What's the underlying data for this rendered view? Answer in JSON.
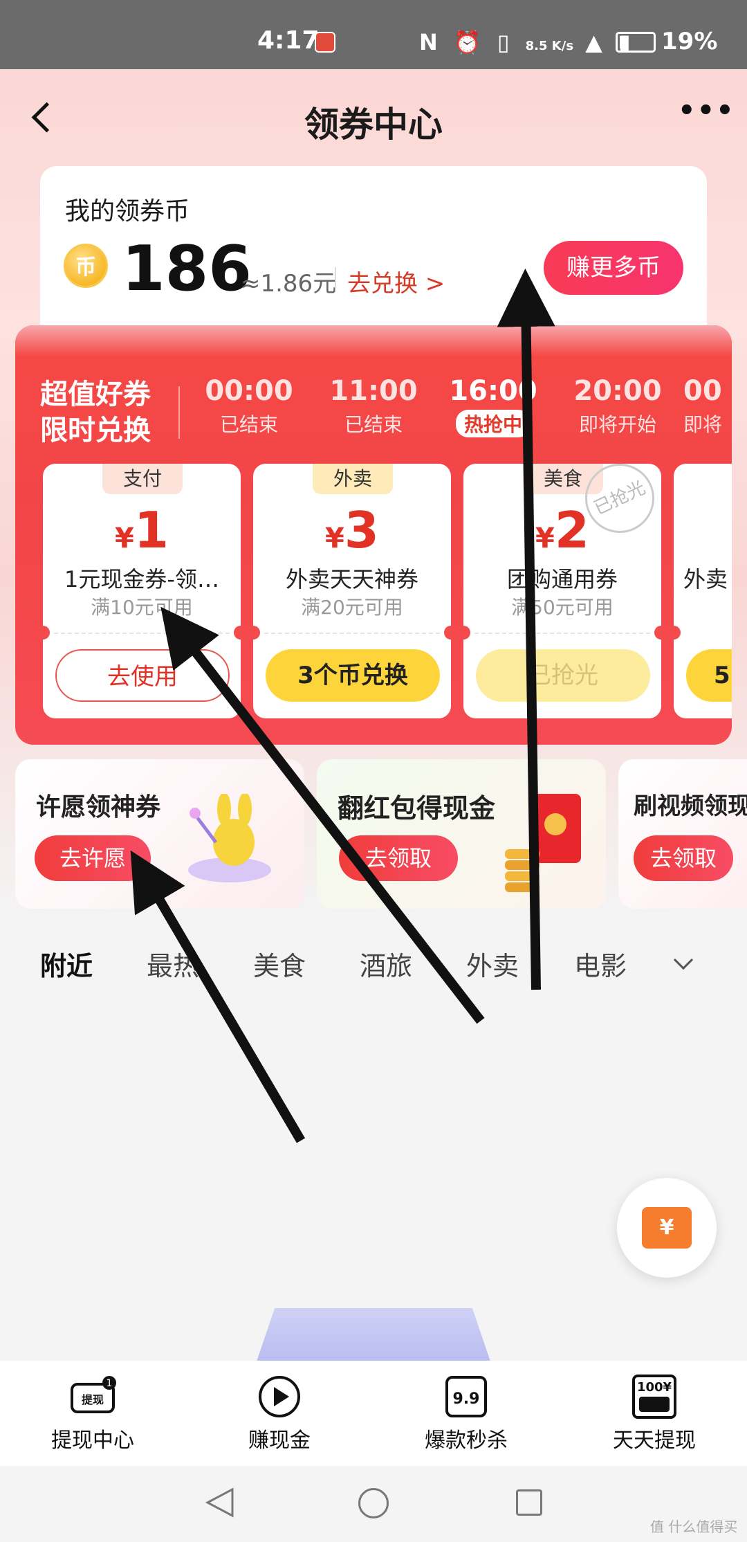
{
  "status_bar": {
    "time": "4:17",
    "net_speed": "8.5 K/s",
    "battery": "19%"
  },
  "header": {
    "title": "领券中心"
  },
  "coin_card": {
    "title": "我的领券币",
    "coin_symbol": "币",
    "balance": "186",
    "cash_equivalent": "≈1.86元",
    "exchange_link": "去兑换 >",
    "earn_button": "赚更多币"
  },
  "flash_sale": {
    "title_line1": "超值好券",
    "title_line2": "限时兑换",
    "slots": [
      {
        "time": "00:00",
        "status": "已结束"
      },
      {
        "time": "11:00",
        "status": "已结束"
      },
      {
        "time": "16:00",
        "status": "热抢中"
      },
      {
        "time": "20:00",
        "status": "即将开始"
      },
      {
        "time": "00",
        "status": "即将"
      }
    ],
    "coupons": [
      {
        "tag": "支付",
        "yen": "¥",
        "amount": "1",
        "name": "1元现金券-领…",
        "condition": "满10元可用",
        "button": "去使用"
      },
      {
        "tag": "外卖",
        "yen": "¥",
        "amount": "3",
        "name": "外卖天天神券",
        "condition": "满20元可用",
        "button": "3个币兑换"
      },
      {
        "tag": "美食",
        "yen": "¥",
        "amount": "2",
        "name": "团购通用券",
        "condition": "满50元可用",
        "button": "已抢光",
        "stamp": "已抢光"
      },
      {
        "tag": "",
        "yen": "",
        "amount": "",
        "name": "外卖",
        "condition": "",
        "button": "5"
      }
    ]
  },
  "tasks": [
    {
      "title": "许愿领神券",
      "button": "去许愿"
    },
    {
      "title": "翻红包得现金",
      "button": "去领取"
    },
    {
      "title": "刷视频领现",
      "button": "去领取"
    }
  ],
  "feed_tabs": [
    "附近",
    "最热",
    "美食",
    "酒旅",
    "外卖",
    "电影"
  ],
  "bottom_nav": [
    {
      "label": "提现中心",
      "icon_text": "提现",
      "badge": "1"
    },
    {
      "label": "赚现金",
      "icon_text": ""
    },
    {
      "label": "爆款秒杀",
      "icon_text": "9.9"
    },
    {
      "label": "天天提现",
      "icon_text": "100¥"
    }
  ],
  "float_button": {
    "symbol": "¥"
  },
  "watermark": "值 什么值得买",
  "colors": {
    "accent": "#f64a45",
    "brand_red": "#e23226",
    "yellow": "#fdd53a"
  }
}
